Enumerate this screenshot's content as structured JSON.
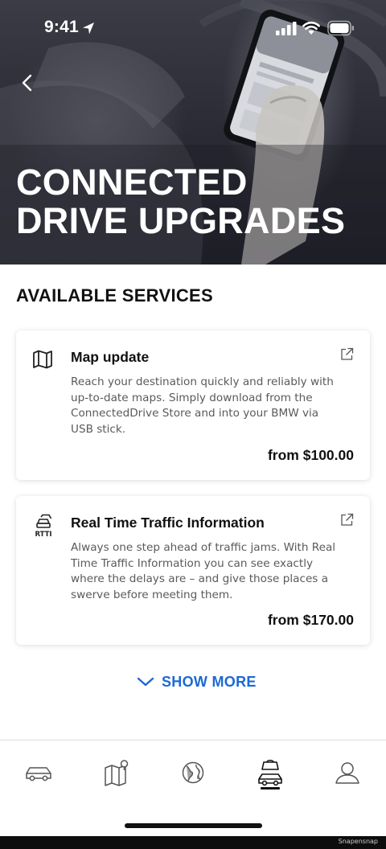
{
  "status_bar": {
    "time": "9:41"
  },
  "hero": {
    "title_line1": "CONNECTED",
    "title_line2": "DRIVE UPGRADES"
  },
  "section": {
    "title": "AVAILABLE SERVICES"
  },
  "services": [
    {
      "icon": "map-icon",
      "title": "Map update",
      "description": "Reach your destination quickly and reliably with up-to-date maps. Simply download from the ConnectedDrive Store and into your BMW via USB stick.",
      "price": "from $100.00"
    },
    {
      "icon": "rtti-icon",
      "icon_label": "RTTI",
      "title": "Real Time Traffic Information",
      "description": "Always one step ahead of traffic jams. With Real Time Traffic Information you can see exactly where the delays are – and give those places a swerve before meeting them.",
      "price": "from $170.00"
    }
  ],
  "show_more": {
    "label": "SHOW MORE"
  },
  "tab_bar": {
    "tabs": [
      {
        "icon": "car-icon"
      },
      {
        "icon": "map-pin-icon"
      },
      {
        "icon": "globe-icon"
      },
      {
        "icon": "shop-bag-car-icon",
        "selected": true
      },
      {
        "icon": "profile-icon"
      }
    ]
  },
  "footer": {
    "watermark": "Snapensnap"
  },
  "colors": {
    "accent": "#1c69d4",
    "text": "#111111",
    "muted_text": "#5a5a5a",
    "hero_bg": "#2c2c36"
  }
}
